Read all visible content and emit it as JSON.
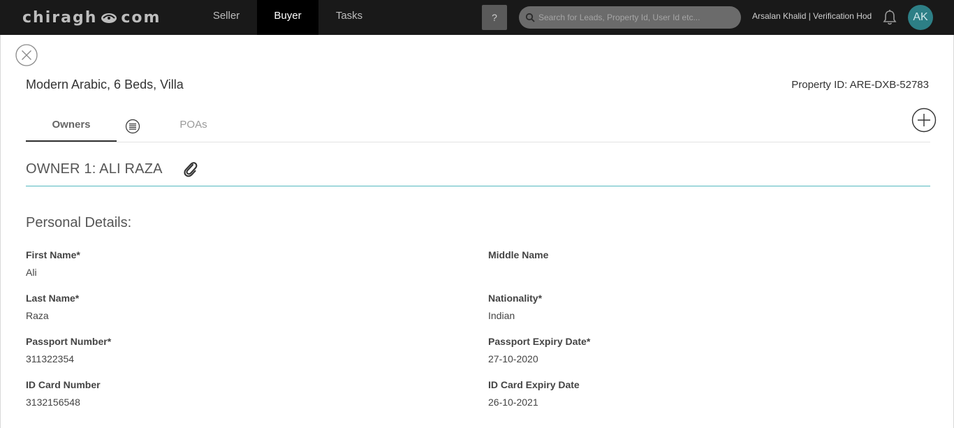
{
  "nav": {
    "logo_text_left": "chiragh",
    "logo_text_right": "com",
    "tabs": [
      "Seller",
      "Buyer",
      "Tasks"
    ],
    "active_tab": "Buyer",
    "help_label": "?",
    "search_placeholder": "Search for Leads, Property Id, User Id etc...",
    "user_label": "Arsalan Khalid | Verification Hod",
    "avatar_initials": "AK",
    "avatar_color": "#2d7f86"
  },
  "property": {
    "title": "Modern Arabic, 6 Beds, Villa",
    "id_label": "Property ID: ARE-DXB-52783"
  },
  "tabs": {
    "owners_label": "Owners",
    "poas_label": "POAs"
  },
  "owner": {
    "heading": "OWNER 1: ALI RAZA"
  },
  "personal_details": {
    "section_title": "Personal Details:",
    "fields": [
      {
        "label": "First Name*",
        "value": "Ali"
      },
      {
        "label": "Middle Name",
        "value": ""
      },
      {
        "label": "Last Name*",
        "value": "Raza"
      },
      {
        "label": "Nationality*",
        "value": "Indian"
      },
      {
        "label": "Passport Number*",
        "value": "311322354"
      },
      {
        "label": "Passport Expiry Date*",
        "value": "27-10-2020"
      },
      {
        "label": "ID Card Number",
        "value": "3132156548"
      },
      {
        "label": "ID Card Expiry Date",
        "value": "26-10-2021"
      }
    ]
  },
  "colors": {
    "navbar": "#191919",
    "accent_rule": "#54b8c0"
  }
}
